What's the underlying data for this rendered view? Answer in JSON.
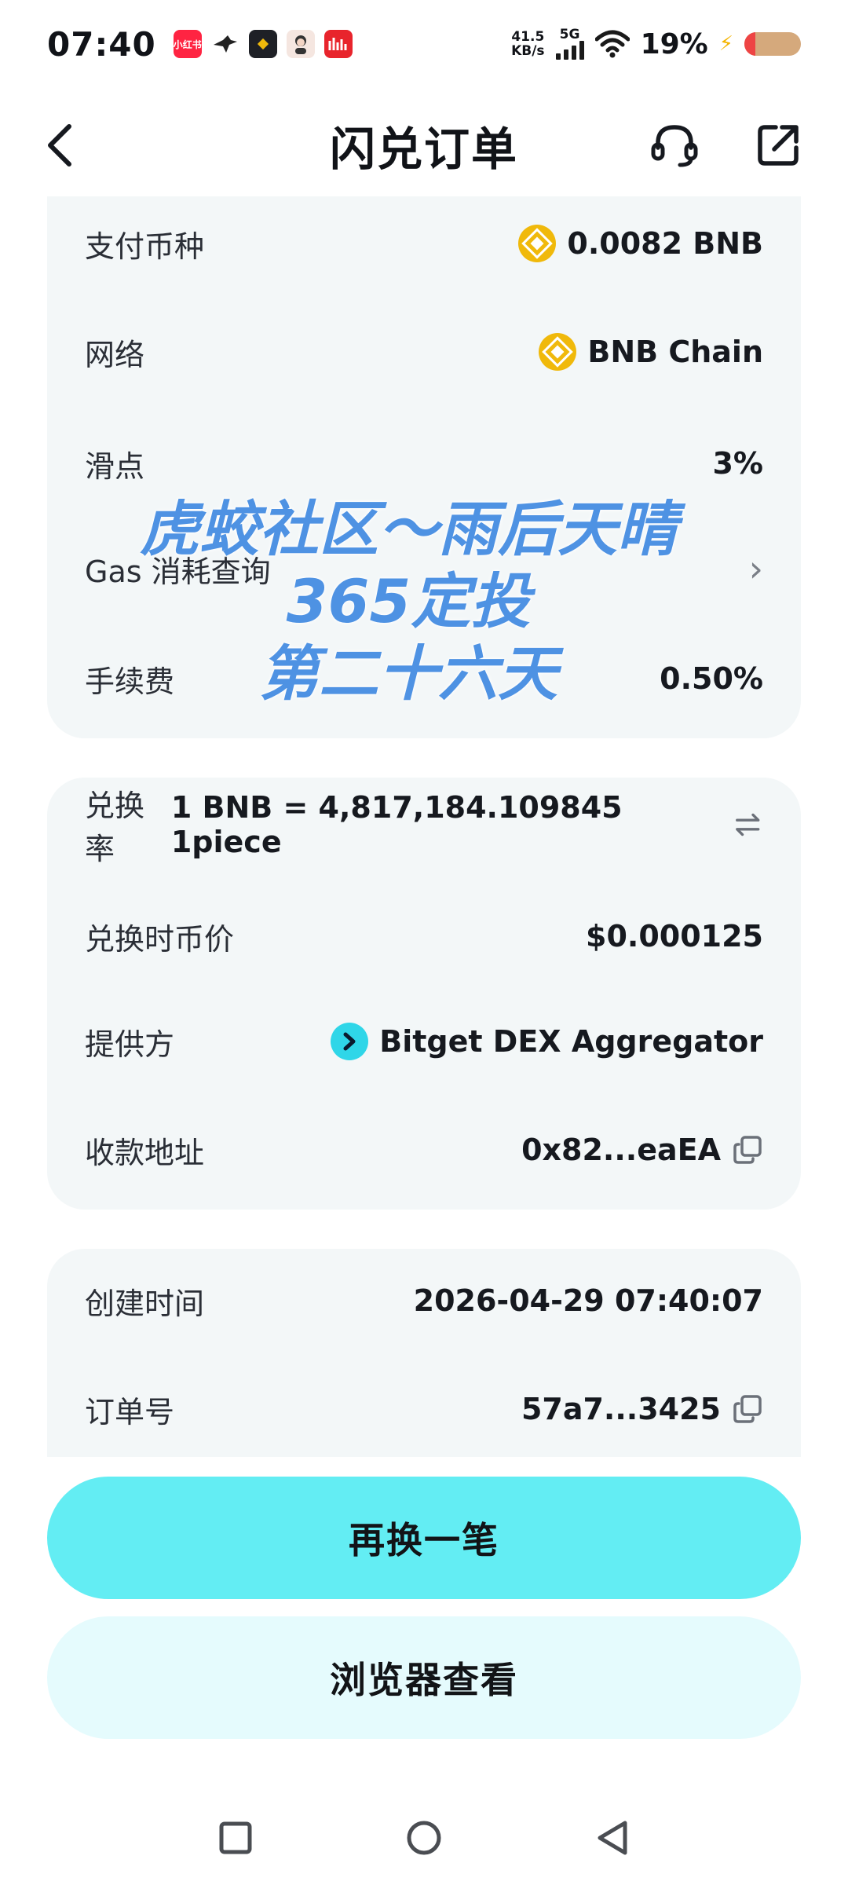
{
  "status_bar": {
    "time": "07:40",
    "net_speed_value": "41.5",
    "net_speed_unit": "KB/s",
    "network_type": "5G",
    "battery_percent": "19%",
    "app_icons": [
      "xiaohongshu",
      "bird",
      "binance",
      "avatar",
      "red-app"
    ]
  },
  "header": {
    "title": "闪兑订单",
    "back_icon": "chevron-left-icon",
    "support_icon": "headset-icon",
    "share_icon": "share-icon"
  },
  "order_info": {
    "pay_currency_label": "支付币种",
    "pay_currency_value": "0.0082 BNB",
    "network_label": "网络",
    "network_value": "BNB Chain",
    "slippage_label": "滑点",
    "slippage_value": "3%",
    "gas_label": "Gas 消耗查询",
    "fee_label": "手续费",
    "fee_value": "0.50%"
  },
  "exchange_info": {
    "rate_label": "兑换率",
    "rate_value": "1 BNB = 4,817,184.109845 1piece",
    "price_label": "兑换时币价",
    "price_value": "$0.000125",
    "provider_label": "提供方",
    "provider_value": "Bitget DEX Aggregator",
    "address_label": "收款地址",
    "address_value": "0x82...eaEA"
  },
  "meta_info": {
    "created_label": "创建时间",
    "created_value": "2026-04-29 07:40:07",
    "order_no_label": "订单号",
    "order_no_value": "57a7...3425"
  },
  "watermark": {
    "line1": "虎蛟社区～雨后天晴",
    "line2": "365定投",
    "line3": "第二十六天"
  },
  "actions": {
    "primary_label": "再换一笔",
    "secondary_label": "浏览器查看"
  },
  "colors": {
    "primary_button": "#63edf3",
    "secondary_button": "#e5fbfd",
    "card_background": "#f3f7f8",
    "watermark": "#4e92e3",
    "bnb": "#f0b90b"
  }
}
